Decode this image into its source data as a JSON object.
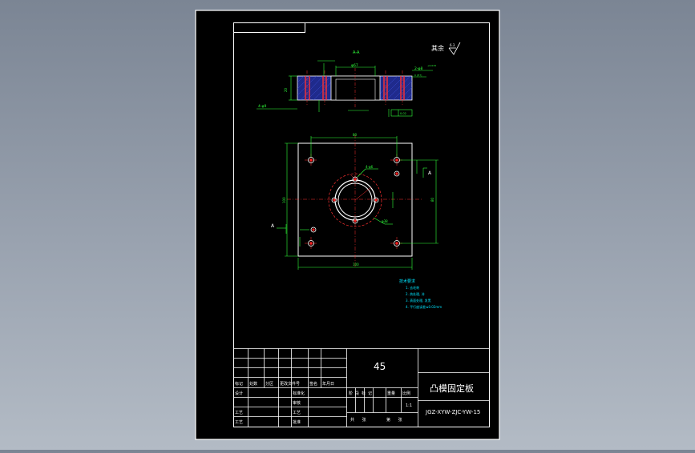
{
  "drawing": {
    "section_label": "A-A",
    "roughness_note": "其余",
    "roughness_value": "6.3",
    "dim_top_width": "φ67",
    "dim_left_holes": "4-φ9",
    "dim_right_holes": "2-φ8",
    "dim_right_tol": "+0.015",
    "dim_right_sub": "  0 (H7)",
    "dim_height": "20",
    "dim_flatness": "0.02",
    "dim_top_view_width": "80",
    "dim_top_view_height": "80",
    "dim_bottom_width": "100",
    "dim_left_height": "100",
    "dim_circle": "φ38",
    "dim_pin_label": "4-φ6",
    "section_mark_left": "A",
    "section_mark_right": "A"
  },
  "tech_req": {
    "title": "技术要求",
    "items": [
      "1. 去毛刺",
      "2. 热处理, 淬",
      "3. 表面处理, 发黑",
      "4. 平行度误差≤0.02mm"
    ]
  },
  "title_block": {
    "material": "45",
    "part_name": "凸模固定板",
    "drawing_no": "JGZ-XYW-ZJC-YW-15",
    "scale": "1:1",
    "labels": {
      "mark": "标记",
      "count": "处数",
      "zone": "分区",
      "change_doc": "更改文件号",
      "sign": "签名",
      "date": "年月日",
      "design": "设计",
      "standardize": "标准化",
      "review": "审核",
      "process": "工艺",
      "craft": "工艺",
      "approve": "批准",
      "stage_mark": "阶段标记",
      "weight": "重量",
      "ratio": "比例",
      "sheets_total": "共 张",
      "sheet_no": "第 张"
    }
  }
}
